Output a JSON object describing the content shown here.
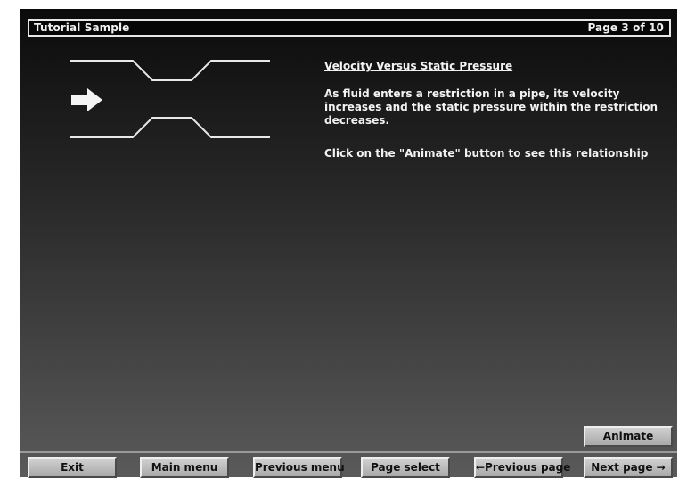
{
  "header": {
    "title": "Tutorial Sample",
    "page_indicator": "Page 3 of 10"
  },
  "content": {
    "heading": "Velocity Versus Static Pressure",
    "body": "As fluid enters a restriction in a pipe, its velocity increases and the static pressure within the restriction decreases.",
    "instruction": "Click on the \"Animate\" button to see this relationship",
    "diagram_icon": "right-arrow-icon"
  },
  "buttons": {
    "animate": "Animate"
  },
  "nav": {
    "exit": "Exit",
    "main_menu": "Main menu",
    "previous_menu": "Previous menu",
    "page_select": "Page select",
    "previous_page": "←Previous page",
    "next_page": "Next page →"
  },
  "colors": {
    "background_top": "#0b0b0b",
    "background_bottom": "#5a5a5a",
    "text": "#f2f2f2",
    "button_face": "#bdbdbd"
  }
}
